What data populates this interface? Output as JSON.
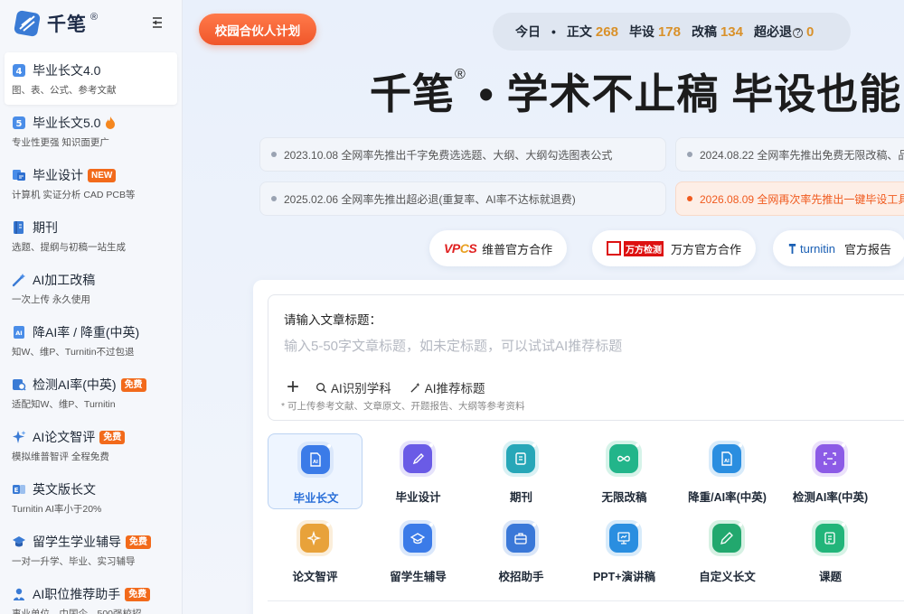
{
  "brand": {
    "name": "千笔",
    "reg": "®"
  },
  "sidebar": {
    "items": [
      {
        "icon": "number-4-icon",
        "title": "毕业长文4.0",
        "sub": "图、表、公式、参考文献",
        "badge": "",
        "active": true
      },
      {
        "icon": "number-5-icon",
        "title": "毕业长文5.0",
        "sub": "专业性更强 知识面更广",
        "badge": "",
        "fire": true
      },
      {
        "icon": "design-icon",
        "title": "毕业设计",
        "sub": "计算机 实证分析 CAD PCB等",
        "badge": "NEW"
      },
      {
        "icon": "journal-icon",
        "title": "期刊",
        "sub": "选题、提纲与初稿一站生成",
        "badge": ""
      },
      {
        "icon": "magic-pen-icon",
        "title": "AI加工改稿",
        "sub": "一次上传 永久使用",
        "badge": ""
      },
      {
        "icon": "ai-reduce-icon",
        "title": "降AI率 / 降重(中英)",
        "sub": "知W、维P、Turnitin不过包退",
        "badge": ""
      },
      {
        "icon": "detect-icon",
        "title": "检测AI率(中英)",
        "sub": "适配知W、维P、Turnitin",
        "badge": "免费"
      },
      {
        "icon": "sparkle-icon",
        "title": "AI论文智评",
        "sub": "模拟维普智评 全程免费",
        "badge": "免费"
      },
      {
        "icon": "english-doc-icon",
        "title": "英文版长文",
        "sub": "Turnitin AI率小于20%",
        "badge": ""
      },
      {
        "icon": "graduation-cap-icon",
        "title": "留学生学业辅导",
        "sub": "一对一升学、毕业、实习辅导",
        "badge": "免费"
      },
      {
        "icon": "person-badge-icon",
        "title": "AI职位推荐助手",
        "sub": "事业单位、中国企、500强校招",
        "badge": "免费"
      }
    ]
  },
  "header": {
    "partner_label": "校园合伙人计划",
    "stats": {
      "today": "今日",
      "dot": "•",
      "zhengwen_label": "正文",
      "zhengwen": "268",
      "bishe_label": "毕设",
      "bishe": "178",
      "gaigao_label": "改稿",
      "gaigao": "134",
      "chaobitui_label": "超必退",
      "chaobitui_q": "?",
      "chaobitui": "0"
    }
  },
  "hero": {
    "brand": "千笔",
    "reg": "®",
    "text": " • 学术不止稿  毕设也能"
  },
  "news": [
    {
      "text": "2023.10.08 全网率先推出千字免费选选题、大纲、大纲勾选图表公式",
      "hot": false
    },
    {
      "text": "2024.08.22 全网率先推出免费无限改稿、品",
      "hot": false
    },
    {
      "text": "2025.02.06 全网率先推出超必退(重复率、AI率不达标就退费)",
      "hot": false
    },
    {
      "text": "2026.08.09 全网再次率先推出一键毕设工具",
      "hot": true
    }
  ],
  "partners": [
    {
      "logo": "VPCS",
      "label": "维普官方合作"
    },
    {
      "logo": "万方检测",
      "label": "万方官方合作"
    },
    {
      "logo": "turnitin",
      "label": "官方报告"
    }
  ],
  "composer": {
    "label": "请输入文章标题：",
    "placeholder": "输入5-50字文章标题，如未定标题，可以试试AI推荐标题",
    "plus": "+",
    "tool_subject": "AI识别学科",
    "tool_title": "AI推荐标题",
    "hint": "* 可上传参考文献、文章原文、开题报告、大纲等参考资料"
  },
  "tiles": [
    {
      "label": "毕业长文",
      "icon": "doc-ai-icon",
      "color": "#3b7be8",
      "active": true
    },
    {
      "label": "毕业设计",
      "icon": "compass-pen-icon",
      "color": "#6a5be6"
    },
    {
      "label": "期刊",
      "icon": "journal-icon",
      "color": "#27a7b8"
    },
    {
      "label": "无限改稿",
      "icon": "infinity-icon",
      "color": "#22b58a"
    },
    {
      "label": "降重/AI率(中英)",
      "icon": "doc-ai-icon",
      "color": "#2a8ee0"
    },
    {
      "label": "检测AI率(中英)",
      "icon": "scan-icon",
      "color": "#8c5be6"
    },
    {
      "label": "论文智评",
      "icon": "sparkle-icon",
      "color": "#e8a23a"
    },
    {
      "label": "留学生辅导",
      "icon": "graduation-cap-icon",
      "color": "#3b7be8"
    },
    {
      "label": "校招助手",
      "icon": "briefcase-icon",
      "color": "#3a78d8"
    },
    {
      "label": "PPT+演讲稿",
      "icon": "presentation-icon",
      "color": "#2a8ee0"
    },
    {
      "label": "自定义长文",
      "icon": "pencil-icon",
      "color": "#22a86e"
    },
    {
      "label": "课题",
      "icon": "clipboard-icon",
      "color": "#22b57a"
    }
  ]
}
